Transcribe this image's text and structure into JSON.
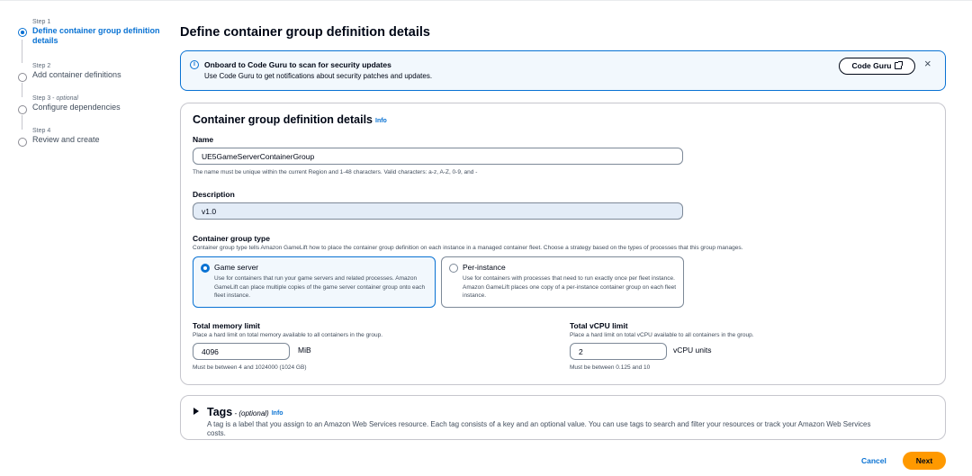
{
  "stepper": {
    "steps": [
      {
        "num": "Step 1",
        "optional": "",
        "title_line1": "Define container group definition",
        "title_line2": "details"
      },
      {
        "num": "Step 2",
        "optional": "",
        "title_line1": "Add container definitions",
        "title_line2": ""
      },
      {
        "num": "Step 3 - ",
        "optional": "optional",
        "title_line1": "Configure dependencies",
        "title_line2": ""
      },
      {
        "num": "Step 4",
        "optional": "",
        "title_line1": "Review and create",
        "title_line2": ""
      }
    ]
  },
  "page": {
    "title": "Define container group definition details"
  },
  "alert": {
    "title": "Onboard to Code Guru to scan for security updates",
    "body": "Use Code Guru to get notifications about security patches and updates.",
    "button_label": "Code Guru",
    "close_icon": "×",
    "info_icon": "i"
  },
  "details": {
    "title": "Container group definition details",
    "info_label": "Info",
    "name": {
      "label": "Name",
      "value": "UE5GameServerContainerGroup",
      "hint": "The name must be unique within the current Region and 1-48 characters. Valid characters: a-z, A-Z, 0-9, and -"
    },
    "description": {
      "label": "Description",
      "value": "v1.0"
    },
    "group_type": {
      "label": "Container group type",
      "hint": "Container group type tells Amazon GameLift how to place the container group definition on each instance in a managed container fleet. Choose a strategy based on the types of processes that this group manages.",
      "options": [
        {
          "title": "Game server",
          "selected": true,
          "desc": "Use for containers that run your game servers and related processes. Amazon GameLift can place multiple copies of the game server container group onto each fleet instance."
        },
        {
          "title": "Per-instance",
          "selected": false,
          "desc": "Use for containers with processes that need to run exactly once per fleet instance. Amazon GameLift places one copy of a per-instance container group on each fleet instance."
        }
      ]
    },
    "memory": {
      "label": "Total memory limit",
      "hint": "Place a hard limit on total memory available to all containers in the group.",
      "value": "4096",
      "unit": "MiB",
      "constraint": "Must be between 4 and 1024000 (1024 GB)"
    },
    "vcpu": {
      "label": "Total vCPU limit",
      "hint": "Place a hard limit on total vCPU available to all containers in the group.",
      "value": "2",
      "unit": "vCPU units",
      "constraint": "Must be between 0.125 and 10"
    }
  },
  "tags": {
    "title": "Tags",
    "optional": " - (optional)",
    "info_label": "Info",
    "body": "A tag is a label that you assign to an Amazon Web Services resource. Each tag consists of a key and an optional value. You can use tags to search and filter your resources or track your Amazon Web Services costs."
  },
  "footer": {
    "cancel_label": "Cancel",
    "next_label": "Next"
  },
  "colors": {
    "accent": "#0972d3",
    "primary_button": "#ff9900",
    "alert_bg": "#f2f8fd"
  }
}
